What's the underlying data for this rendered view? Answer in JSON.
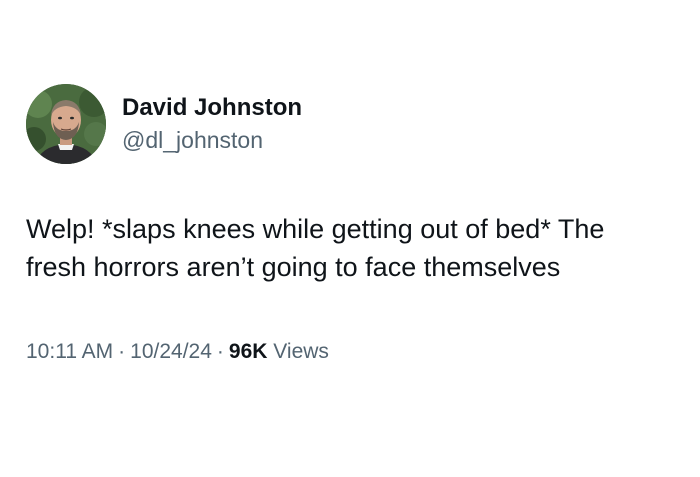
{
  "author": {
    "display_name": "David Johnston",
    "handle": "@dl_johnston"
  },
  "tweet": {
    "text": "Welp! *slaps knees while getting out of bed* The\nfresh horrors aren’t going to face themselves"
  },
  "meta": {
    "time": "10:11 AM",
    "separator": "·",
    "date": "10/24/24",
    "views_count": "96K",
    "views_label": "Views"
  },
  "colors": {
    "text_primary": "#0f1419",
    "text_secondary": "#536471",
    "background": "#ffffff"
  }
}
